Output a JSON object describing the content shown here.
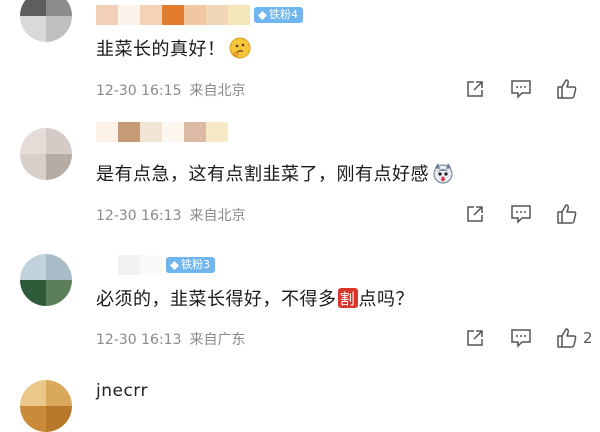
{
  "comments": [
    {
      "fan_badge": "铁粉4",
      "text": "韭菜长的真好！",
      "emoji": "thinking-face-emoji",
      "time": "12-30 16:15",
      "location": "来自北京",
      "like_count": ""
    },
    {
      "fan_badge": "",
      "text": "是有点急，这有点割韭菜了，刚有点好感",
      "emoji": "husky-dog-emoji",
      "time": "12-30 16:13",
      "location": "来自北京",
      "like_count": ""
    },
    {
      "fan_badge": "铁粉3",
      "text_before": "必须的，韭菜长得好，不得多",
      "text_boxed": "割",
      "text_after": "点吗？",
      "time": "12-30 16:13",
      "location": "来自广东",
      "like_count": "2"
    },
    {
      "handle": "jnecrr"
    }
  ],
  "icons": {
    "share": "share-icon",
    "comment": "comment-icon",
    "like": "thumbs-up-icon"
  },
  "colors": {
    "badge": "#6fb5f0",
    "meta_text": "#8a8a8a",
    "boxed_char_bg": "#d8362a"
  }
}
